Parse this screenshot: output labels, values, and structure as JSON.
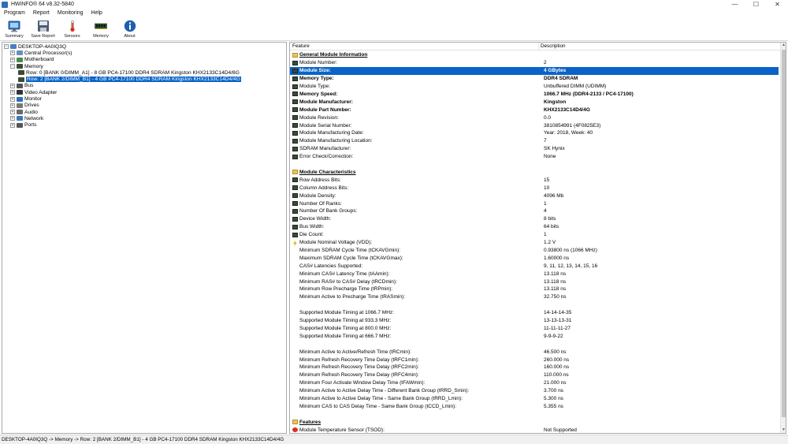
{
  "window": {
    "title": "HWiNFO® 64 v8.32-5840",
    "minimize": "—",
    "maximize": "☐",
    "close": "✕"
  },
  "menu": [
    "Program",
    "Report",
    "Monitoring",
    "Help"
  ],
  "toolbar": [
    {
      "label": "Summary",
      "icon": "summary-icon"
    },
    {
      "label": "Save Report",
      "icon": "save-report-icon"
    },
    {
      "label": "Sensors",
      "icon": "sensors-icon"
    },
    {
      "label": "Memory",
      "icon": "memory-icon"
    },
    {
      "label": "About",
      "icon": "about-icon"
    }
  ],
  "tree": {
    "root": "DESKTOP-4A0IQ3Q",
    "nodes": [
      {
        "label": "Central Processor(s)",
        "color": "#6d8fb5",
        "level": 1
      },
      {
        "label": "Motherboard",
        "color": "#4b8b4b",
        "level": 1
      },
      {
        "label": "Memory",
        "color": "#3a4a3a",
        "level": 1,
        "expanded": true
      },
      {
        "label": "Row: 0 [BANK 0/DIMM_A1] - 8 GB PC4-17100 DDR4 SDRAM Kingston KHX2133C14D4/8G",
        "color": "#3a4a3a",
        "level": 2
      },
      {
        "label": "Row: 2 [BANK 2/DIMM_B1] - 4 GB PC4-17100 DDR4 SDRAM Kingston KHX2133C14D4/4G",
        "color": "#3a4a3a",
        "level": 2,
        "selected": true
      },
      {
        "label": "Bus",
        "color": "#555",
        "level": 1
      },
      {
        "label": "Video Adapter",
        "color": "#333",
        "level": 1
      },
      {
        "label": "Monitor",
        "color": "#2d6fb3",
        "level": 1
      },
      {
        "label": "Drives",
        "color": "#777",
        "level": 1
      },
      {
        "label": "Audio",
        "color": "#6a6a6a",
        "level": 1
      },
      {
        "label": "Network",
        "color": "#3d78b8",
        "level": 1
      },
      {
        "label": "Ports",
        "color": "#555",
        "level": 1
      }
    ]
  },
  "columns": {
    "feature": "Feature",
    "description": "Description"
  },
  "rows": [
    {
      "type": "section",
      "icon": "folder",
      "feature": "General Module Information",
      "desc": ""
    },
    {
      "icon": "chip",
      "feature": "Module Number:",
      "desc": "2"
    },
    {
      "icon": "chip",
      "feature": "Module Size:",
      "desc": "4 GBytes",
      "selected": true,
      "bold": true
    },
    {
      "icon": "chip",
      "feature": "Memory Type:",
      "desc": "DDR4 SDRAM",
      "bold": true
    },
    {
      "icon": "chip",
      "feature": "Module Type:",
      "desc": "Unbuffered DIMM (UDIMM)"
    },
    {
      "icon": "chip",
      "feature": "Memory Speed:",
      "desc": "1066.7 MHz (DDR4-2133 / PC4-17100)",
      "bold": true
    },
    {
      "icon": "chip",
      "feature": "Module Manufacturer:",
      "desc": "Kingston",
      "bold": true
    },
    {
      "icon": "chip",
      "feature": "Module Part Number:",
      "desc": "KHX2133C14D4/4G",
      "bold": true
    },
    {
      "icon": "chip",
      "feature": "Module Revision:",
      "desc": "0.0"
    },
    {
      "icon": "chip",
      "feature": "Module Serial Number:",
      "desc": "3810854991 (4F0825E3)"
    },
    {
      "icon": "chip",
      "feature": "Module Manufacturing Date:",
      "desc": "Year: 2018, Week: 40"
    },
    {
      "icon": "chip",
      "feature": "Module Manufacturing Location:",
      "desc": "7"
    },
    {
      "icon": "chip",
      "feature": "SDRAM Manufacturer:",
      "desc": "SK Hynix"
    },
    {
      "icon": "chip",
      "feature": "Error Check/Correction:",
      "desc": "None"
    },
    {
      "type": "blank"
    },
    {
      "type": "section",
      "icon": "folder",
      "feature": "Module Characteristics",
      "desc": ""
    },
    {
      "icon": "chip",
      "feature": "Row Address Bits:",
      "desc": "15"
    },
    {
      "icon": "chip",
      "feature": "Column Address Bits:",
      "desc": "10"
    },
    {
      "icon": "chip",
      "feature": "Module Density:",
      "desc": "4096 Mb"
    },
    {
      "icon": "chip",
      "feature": "Number Of Ranks:",
      "desc": "1"
    },
    {
      "icon": "chip",
      "feature": "Number Of Bank Groups:",
      "desc": "4"
    },
    {
      "icon": "chip",
      "feature": "Device Width:",
      "desc": "8 bits"
    },
    {
      "icon": "chip",
      "feature": "Bus Width:",
      "desc": "64 bits"
    },
    {
      "icon": "chip",
      "feature": "Die Count:",
      "desc": "1"
    },
    {
      "icon": "bolt",
      "feature": "Module Nominal Voltage (VDD):",
      "desc": "1.2 V"
    },
    {
      "icon": "none",
      "feature": "Minimum SDRAM Cycle Time (tCKAVGmin):",
      "desc": "0.93800 ns (1066 MHz)"
    },
    {
      "icon": "none",
      "feature": "Maximum SDRAM Cycle Time (tCKAVGmax):",
      "desc": "1.60000 ns"
    },
    {
      "icon": "none",
      "feature": "CAS# Latencies Supported:",
      "desc": "9, 11, 12, 13, 14, 15, 16"
    },
    {
      "icon": "none",
      "feature": "Minimum CAS# Latency Time (tAAmin):",
      "desc": "13.118 ns"
    },
    {
      "icon": "none",
      "feature": "Minimum RAS# to CAS# Delay (tRCDmin):",
      "desc": "13.118 ns"
    },
    {
      "icon": "none",
      "feature": "Minimum Row Precharge Time (tRPmin):",
      "desc": "13.118 ns"
    },
    {
      "icon": "none",
      "feature": "Minimum Active to Precharge Time (tRASmin):",
      "desc": "32.750 ns"
    },
    {
      "type": "blank"
    },
    {
      "icon": "none",
      "feature": "Supported Module Timing at 1066.7 MHz:",
      "desc": "14-14-14-35"
    },
    {
      "icon": "none",
      "feature": "Supported Module Timing at 933.3 MHz:",
      "desc": "13-13-13-31"
    },
    {
      "icon": "none",
      "feature": "Supported Module Timing at 800.0 MHz:",
      "desc": "11-11-11-27"
    },
    {
      "icon": "none",
      "feature": "Supported Module Timing at 666.7 MHz:",
      "desc": "9-9-9-22"
    },
    {
      "type": "blank"
    },
    {
      "icon": "none",
      "feature": "Minimum Active to Active/Refresh Time (tRCmin):",
      "desc": "46.500 ns"
    },
    {
      "icon": "none",
      "feature": "Minimum Refresh Recovery Time Delay (tRFC1min):",
      "desc": "260.000 ns"
    },
    {
      "icon": "none",
      "feature": "Minimum Refresh Recovery Time Delay (tRFC2min):",
      "desc": "160.000 ns"
    },
    {
      "icon": "none",
      "feature": "Minimum Refresh Recovery Time Delay (tRFC4min):",
      "desc": "110.000 ns"
    },
    {
      "icon": "none",
      "feature": "Minimum Four Activate Window Delay Time (tFAWmin):",
      "desc": "21.000 ns"
    },
    {
      "icon": "none",
      "feature": "Minimum Active to Active Delay Time - Different Bank Group (tRRD_Smin):",
      "desc": "3.700 ns"
    },
    {
      "icon": "none",
      "feature": "Minimum Active to Active Delay Time - Same Bank Group (tRRD_Lmin):",
      "desc": "5.300 ns"
    },
    {
      "icon": "none",
      "feature": "Minimum CAS to CAS Delay Time - Same Bank Group (tCCD_Lmin):",
      "desc": "5.355 ns"
    },
    {
      "type": "blank"
    },
    {
      "type": "section",
      "icon": "folder",
      "feature": "Features",
      "desc": ""
    },
    {
      "icon": "warn",
      "feature": "Module Temperature Sensor (TSOD):",
      "desc": "Not Supported"
    }
  ],
  "status": "DESKTOP-4A0IQ3Q -> Memory -> Row: 2 [BANK 2/DIMM_B1] - 4 GB PC4-17100 DDR4 SDRAM Kingston KHX2133C14D4/4G"
}
